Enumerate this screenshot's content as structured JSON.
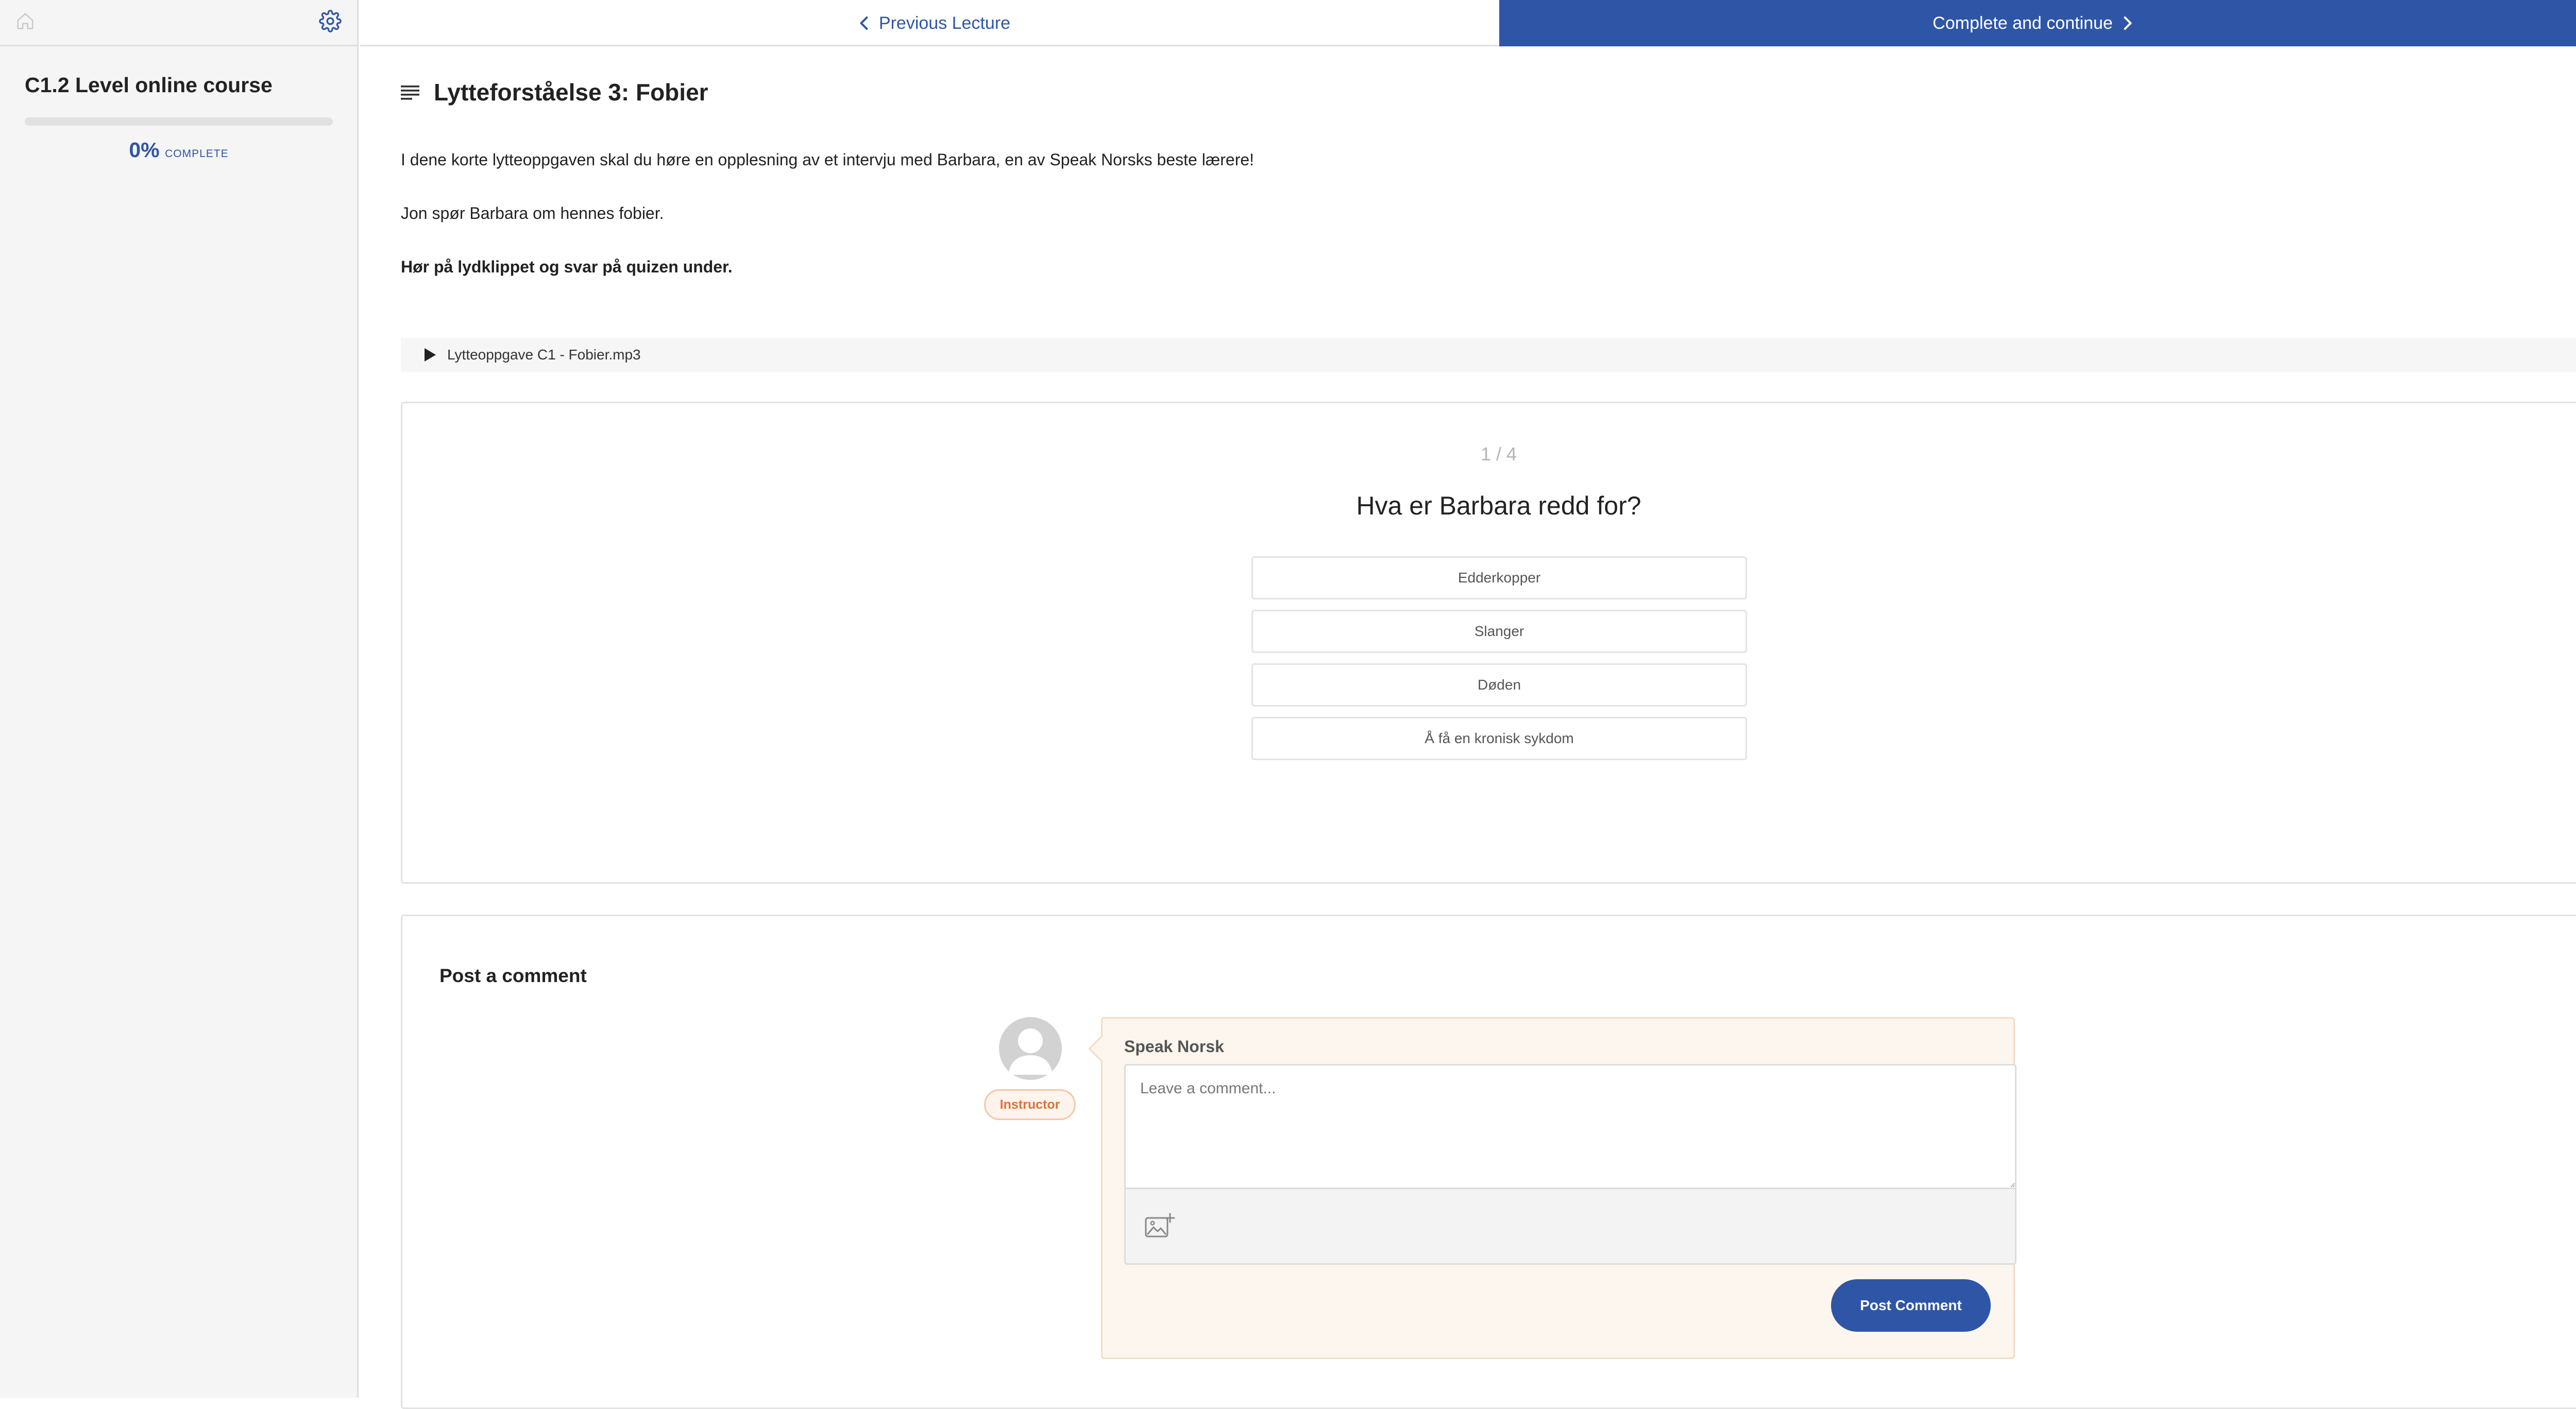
{
  "sidebar": {
    "course_title": "C1.2 Level online course",
    "progress_value": 0,
    "progress_percent": "0%",
    "progress_label": "COMPLETE"
  },
  "nav": {
    "previous_label": "Previous Lecture",
    "next_label": "Complete and continue"
  },
  "lecture": {
    "title": "Lytteforståelse 3: Fobier",
    "paragraphs": [
      "I dene korte lytteoppgaven skal du høre en opplesning av et intervju med Barbara, en av Speak Norsks beste lærere!",
      "Jon spør Barbara om hennes fobier.",
      "Hør på lydklippet og svar på quizen under."
    ],
    "audio_file": "Lytteoppgave C1 - Fobier.mp3"
  },
  "quiz": {
    "counter": "1 / 4",
    "question": "Hva er Barbara redd for?",
    "options": [
      "Edderkopper",
      "Slanger",
      "Døden",
      "Å få en kronisk sykdom"
    ]
  },
  "comments": {
    "heading": "Post a comment",
    "author_name": "Speak Norsk",
    "badge": "Instructor",
    "placeholder": "Leave a comment...",
    "post_label": "Post Comment"
  },
  "colors": {
    "accent": "#2f56a6",
    "badge": "#e0703a"
  }
}
